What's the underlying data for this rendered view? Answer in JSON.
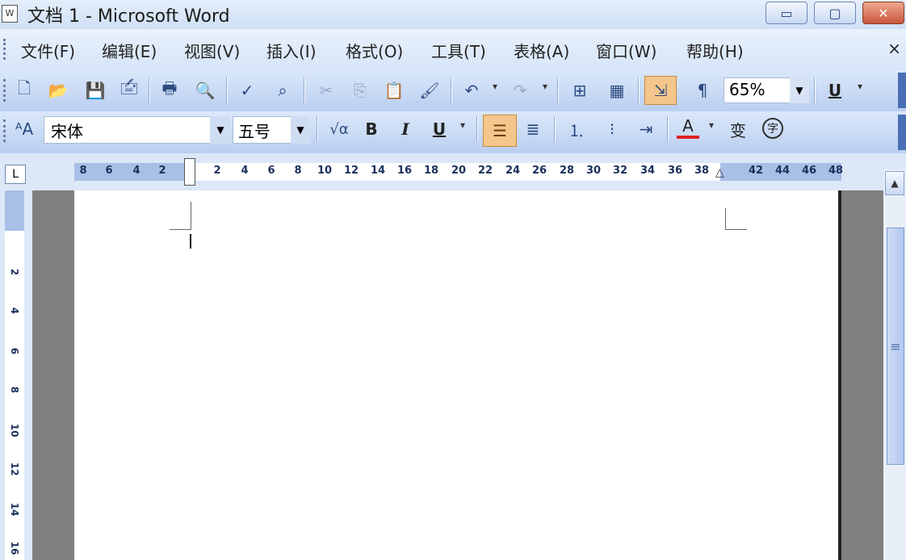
{
  "window": {
    "title": "文档 1 - Microsoft Word",
    "app_icon": "W",
    "controls": {
      "minimize": "▭",
      "maximize": "▢",
      "close": "✕"
    }
  },
  "menu": {
    "items": [
      "文件(F)",
      "编辑(E)",
      "视图(V)",
      "插入(I)",
      "格式(O)",
      "工具(T)",
      "表格(A)",
      "窗口(W)",
      "帮助(H)"
    ],
    "close": "×"
  },
  "standard_toolbar": {
    "icons": [
      "new-document-icon",
      "open-folder-icon",
      "save-icon",
      "permission-icon",
      "print-icon",
      "print-preview-icon",
      "spelling-icon",
      "research-icon",
      "cut-icon",
      "copy-icon",
      "paste-icon",
      "format-painter-icon",
      "undo-icon",
      "redo-icon",
      "insert-table-icon",
      "insert-excel-icon",
      "document-map-icon",
      "show-hide-icon"
    ],
    "zoom": "65%",
    "underline": "U"
  },
  "formatting_toolbar": {
    "style": "宋体",
    "font_size": "五号",
    "equation": "√α",
    "bold": "B",
    "italic": "I",
    "underline": "U",
    "font_color": "A",
    "phonetic": "变",
    "enclose": "字"
  },
  "ruler": {
    "tab_selector": "L",
    "labels": [
      "8",
      "6",
      "4",
      "2",
      "2",
      "4",
      "6",
      "8",
      "10",
      "12",
      "14",
      "16",
      "18",
      "20",
      "22",
      "24",
      "26",
      "28",
      "30",
      "32",
      "34",
      "36",
      "38",
      "42",
      "44",
      "46",
      "48"
    ]
  },
  "vertical_ruler": {
    "labels": [
      "2",
      "4",
      "6",
      "8",
      "10",
      "12",
      "14",
      "16"
    ]
  },
  "scrollbar": {
    "up": "▲",
    "thumb_grip": "≡"
  },
  "colors": {
    "font_color_underline": "#e02020",
    "active_button": "#f5c68c",
    "page_gray": "#7f7f7f"
  }
}
